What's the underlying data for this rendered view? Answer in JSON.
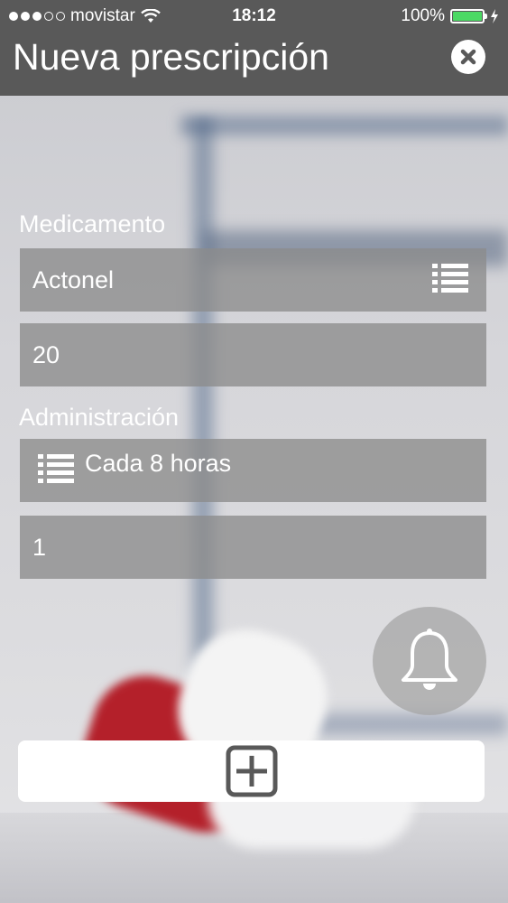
{
  "status_bar": {
    "carrier": "movistar",
    "time": "18:12",
    "battery": "100%",
    "battery_level": 1.0,
    "signal_bars_filled": 3,
    "signal_bars_total": 5
  },
  "nav": {
    "title": "Nueva prescripción",
    "close_icon": "close-icon"
  },
  "form": {
    "medicamento_label": "Medicamento",
    "medicamento_value": "Actonel",
    "dosis_value": "20",
    "administracion_label": "Administración",
    "frecuencia_value": "Cada 8 horas",
    "cantidad_value": "1"
  },
  "icons": {
    "list": "list-icon",
    "bell": "bell-icon",
    "add": "add-icon"
  },
  "colors": {
    "bar": "#595959",
    "field": "#8c8c8c",
    "battery": "#4cd964"
  }
}
